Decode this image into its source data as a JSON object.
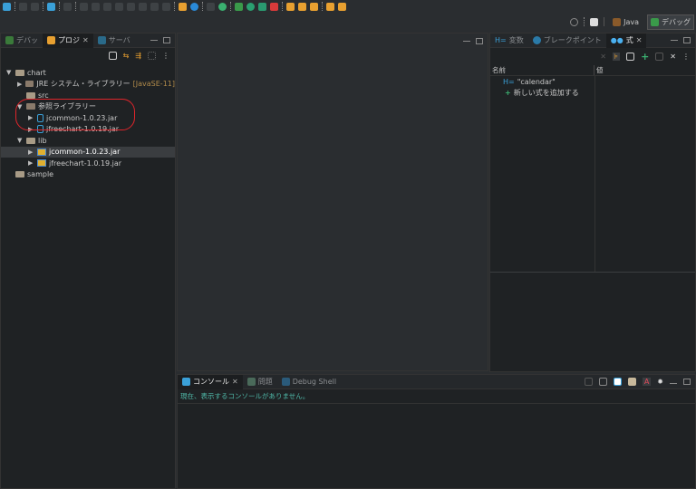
{
  "toolbar": {
    "icons": [
      "new-icon",
      "save-icon",
      "save-all-icon",
      "terminal-icon",
      "skip-breakpoints-icon",
      "resume-icon",
      "suspend-icon",
      "terminate-icon",
      "disconnect-icon",
      "step-into-icon",
      "step-over-icon",
      "step-return-icon",
      "drop-to-frame-icon",
      "use-step-filters-icon",
      "gear-icon",
      "connect-icon",
      "power-icon",
      "debug-icon",
      "run-icon",
      "coverage-icon",
      "external-tools-icon",
      "new-java-project-icon",
      "open-type-icon",
      "search-icon",
      "back-icon",
      "forward-icon"
    ]
  },
  "perspectives": {
    "java": "Java",
    "debug": "デバッグ"
  },
  "left": {
    "tabs": [
      "デバッ",
      "プロジ",
      "サーバ"
    ],
    "tree": [
      {
        "label": "chart",
        "level": 0,
        "icon": "project-folder",
        "expanded": true
      },
      {
        "label": "JRE システム・ライブラリー",
        "suffix": "[JavaSE-11]",
        "level": 1,
        "icon": "library"
      },
      {
        "label": "src",
        "level": 1,
        "icon": "source-folder"
      },
      {
        "label": "参照ライブラリー",
        "level": 1,
        "icon": "library",
        "expanded": true
      },
      {
        "label": "jcommon-1.0.23.jar",
        "level": 2,
        "icon": "jar"
      },
      {
        "label": "jfreechart-1.0.19.jar",
        "level": 2,
        "icon": "jar"
      },
      {
        "label": "lib",
        "level": 1,
        "icon": "folder",
        "expanded": true
      },
      {
        "label": "jcommon-1.0.23.jar",
        "level": 2,
        "icon": "jar-file",
        "selected": true
      },
      {
        "label": "jfreechart-1.0.19.jar",
        "level": 2,
        "icon": "jar-file"
      },
      {
        "label": "sample",
        "level": 0,
        "icon": "folder"
      }
    ],
    "highlight_color": "#e0252b"
  },
  "right": {
    "tabs": [
      "変数",
      "ブレークポイント",
      "式"
    ],
    "columns": [
      "名前",
      "値"
    ],
    "rows": [
      {
        "name": "\"calendar\"",
        "value": ""
      }
    ],
    "add_label": "新しい式を追加する"
  },
  "console": {
    "tabs": [
      "コンソール",
      "問題",
      "Debug Shell"
    ],
    "message": "現在、表示するコンソールがありません。"
  }
}
